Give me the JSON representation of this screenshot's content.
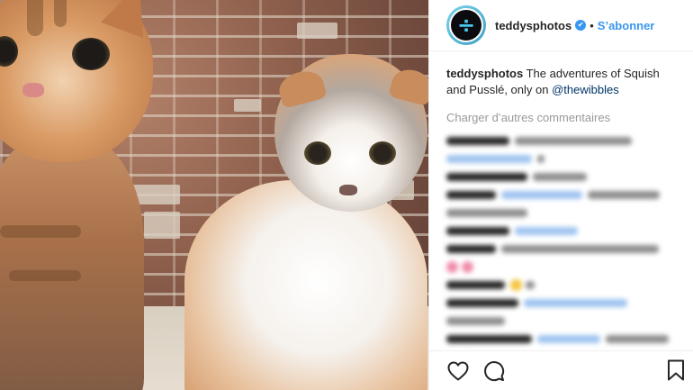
{
  "header": {
    "username": "teddysphotos",
    "verified_glyph": "✔",
    "separator": "•",
    "follow_label": "S’abonner",
    "avatar_glyph": "÷"
  },
  "caption": {
    "username": "teddysphotos",
    "text": " The adventures of Squish and Pusslé, only on ",
    "mention": "@thewibbles"
  },
  "load_more_label": "Charger d’autres commentaires",
  "icons": {
    "like": "heart-icon",
    "comment": "comment-bubble-icon",
    "save": "bookmark-icon",
    "verified": "verified-badge-icon"
  },
  "colors": {
    "accent": "#3897f0",
    "avatar_ring": "#3a9fc4",
    "muted_text": "#999999",
    "mention": "#003569"
  }
}
